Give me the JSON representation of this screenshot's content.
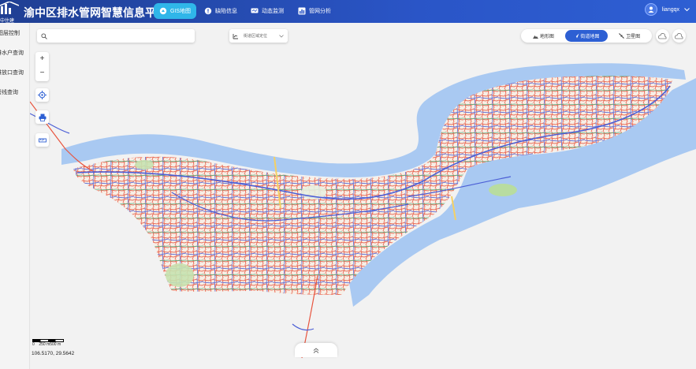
{
  "app": {
    "logo_text": "中住建",
    "title": "渝中区排水管网智慧信息平台"
  },
  "nav": [
    {
      "label": "GIS地图",
      "icon": "gis-map-icon",
      "active": true
    },
    {
      "label": "缺陷信息",
      "icon": "alert-icon",
      "active": false
    },
    {
      "label": "动态监测",
      "icon": "monitor-icon",
      "active": false
    },
    {
      "label": "管网分析",
      "icon": "bar-chart-icon",
      "active": false
    }
  ],
  "user": {
    "name": "liangqx"
  },
  "sidebar": {
    "items": [
      {
        "label": "图层控制"
      },
      {
        "label": "排水户查询"
      },
      {
        "label": "排放口查询"
      },
      {
        "label": "管线查询"
      }
    ]
  },
  "map": {
    "search_placeholder": "",
    "region_label": "街道区域定位",
    "zoom_in": "+",
    "zoom_out": "−",
    "basemaps": [
      {
        "label": "地形图",
        "icon": "terrain-icon",
        "active": false
      },
      {
        "label": "街道地图",
        "icon": "street-map-icon",
        "active": true
      },
      {
        "label": "卫星图",
        "icon": "satellite-icon",
        "active": false
      }
    ],
    "scale_label": "0    250 m500 m",
    "coordinates": "106.5170, 29.5642"
  },
  "colors": {
    "accent": "#2d5fd3",
    "active_nav": "#2fb6e9",
    "pipe_red": "#e8553f",
    "pipe_blue": "#4c5fd6",
    "pipe_green": "#2fa36b",
    "river": "#a9c9f2"
  }
}
